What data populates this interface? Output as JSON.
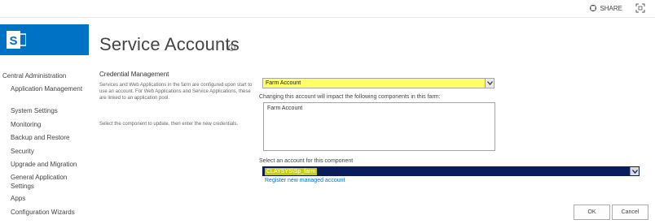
{
  "topbar": {
    "share_label": "SHARE",
    "icons": [
      "share-icon",
      "focus-on-content-icon"
    ]
  },
  "logo": {
    "icon": "sharepoint-logo-icon",
    "color": "#0072c6"
  },
  "page": {
    "title": "Service Accounts"
  },
  "nav": {
    "root": "Central Administration",
    "items": [
      {
        "label": "Application Management"
      },
      {
        "label": "System Settings"
      },
      {
        "label": "Monitoring"
      },
      {
        "label": "Backup and Restore"
      },
      {
        "label": "Security"
      },
      {
        "label": "Upgrade and Migration"
      },
      {
        "label": "General Application Settings"
      },
      {
        "label": "Apps"
      },
      {
        "label": "Configuration Wizards"
      }
    ]
  },
  "credential": {
    "title": "Credential Management",
    "description": "Services and Web Applications in the farm are configured upon start to use an account. For Web Applications and Service Applications, these are linked to an application pool.",
    "instructions": "Select the component to update, then enter the new credentials."
  },
  "component_select": {
    "selected": "Farm Account"
  },
  "impact": {
    "label": "Changing this account will impact the following components in this farm:",
    "components": "Farm Account"
  },
  "account_select": {
    "label": "Select an account for this component",
    "selected": "CLAYSYS\\Sp_farm"
  },
  "register_link": "Register new managed account",
  "buttons": {
    "ok": "OK",
    "cancel": "Cancel"
  },
  "colors": {
    "accent": "#0072c6",
    "highlight": "#ffff00",
    "dropdown_selected": "#0b1c5c"
  }
}
